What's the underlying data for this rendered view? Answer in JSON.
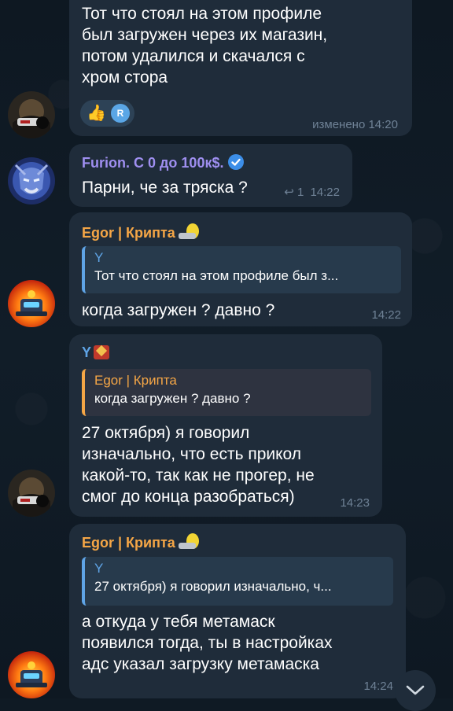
{
  "colors": {
    "background": "#0f1a24",
    "bubble": "#1f2c3a",
    "meta_text": "#6f8296",
    "furion_name": "#9f8ff0",
    "egor_name": "#f5a646",
    "y_name": "#5fa4e6",
    "quote_border": "#5fa4e6",
    "verified": "#3c8ee8"
  },
  "messages": [
    {
      "id": "m1",
      "text_lines": [
        "Тот что стоял на этом профиле",
        "был загружен через их магазин,",
        "потом удалился и скачался с",
        "хром стора"
      ],
      "reaction": {
        "emoji": "👍",
        "avatar_letter": "R"
      },
      "meta": "изменено 14:20",
      "avatar": "dark-avatar"
    },
    {
      "id": "m2",
      "sender": "Furion. С 0 до 100к$.",
      "text": "Парни, че за тряска ?",
      "reply_count": "1",
      "time": "14:22",
      "avatar": "furion-avatar"
    },
    {
      "id": "m3",
      "sender": "Egor | Крипта",
      "quote_name": "Y",
      "quote_text": "Тот что стоял на этом профиле был з...",
      "text": "когда загружен ? давно ?",
      "time": "14:22",
      "avatar": "crypto-avatar"
    },
    {
      "id": "m4",
      "sender": "Y",
      "quote_name": "Egor | Крипта",
      "quote_text": "когда загружен ? давно ?",
      "text_lines": [
        "27 октября) я говорил",
        "изначально, что есть прикол",
        "какой-то, так как не прогер, не",
        "смог до конца разобраться)"
      ],
      "time": "14:23",
      "avatar": "dark-avatar"
    },
    {
      "id": "m5",
      "sender": "Egor | Крипта",
      "quote_name": "Y",
      "quote_text": "27 октября) я говорил изначально, ч...",
      "text_lines": [
        "а откуда у тебя метамаск",
        "появился тогда, ты в настройках",
        "адс указал загрузку метамаска"
      ],
      "time": "14:24",
      "avatar": "crypto-avatar"
    }
  ]
}
